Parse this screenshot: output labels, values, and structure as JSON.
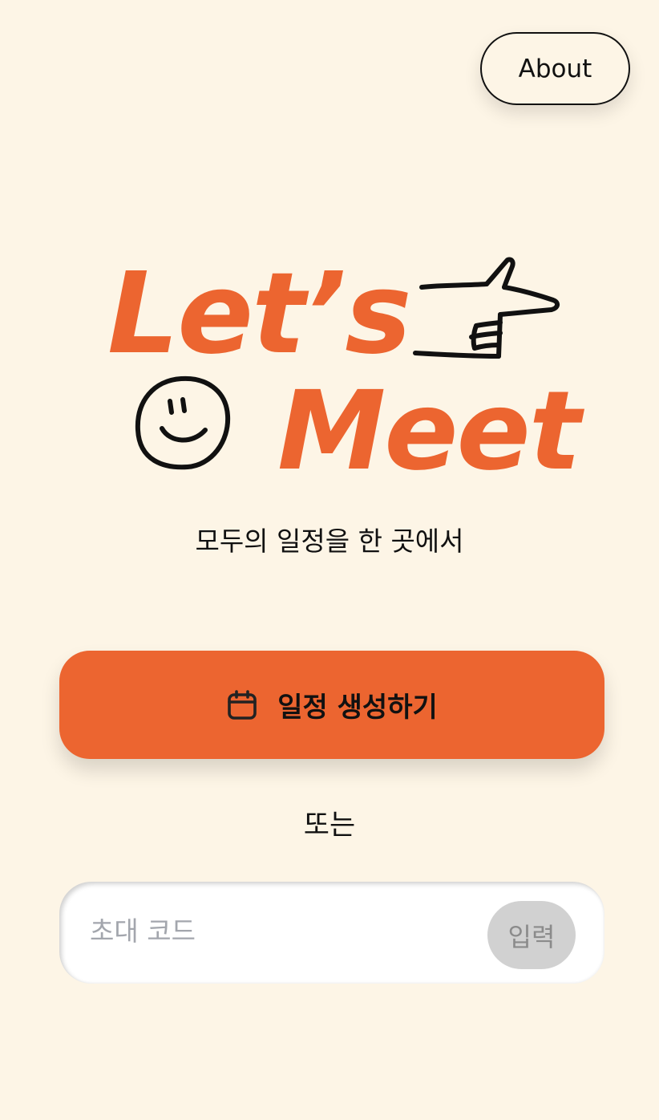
{
  "header": {
    "about_label": "About"
  },
  "logo": {
    "line1": "Let’s",
    "line2": "Meet",
    "icons": [
      "pointing-hand-icon",
      "smiley-face-icon"
    ]
  },
  "hero": {
    "tagline": "모두의 일정을 한 곳에서"
  },
  "actions": {
    "create_label": "일정 생성하기",
    "create_icon": "calendar-icon",
    "or_label": "또는"
  },
  "invite": {
    "placeholder": "초대 코드",
    "value": "",
    "submit_label": "입력"
  },
  "colors": {
    "background": "#fdf5e6",
    "accent": "#ec6530",
    "disabled_button": "#d1d1d1"
  }
}
